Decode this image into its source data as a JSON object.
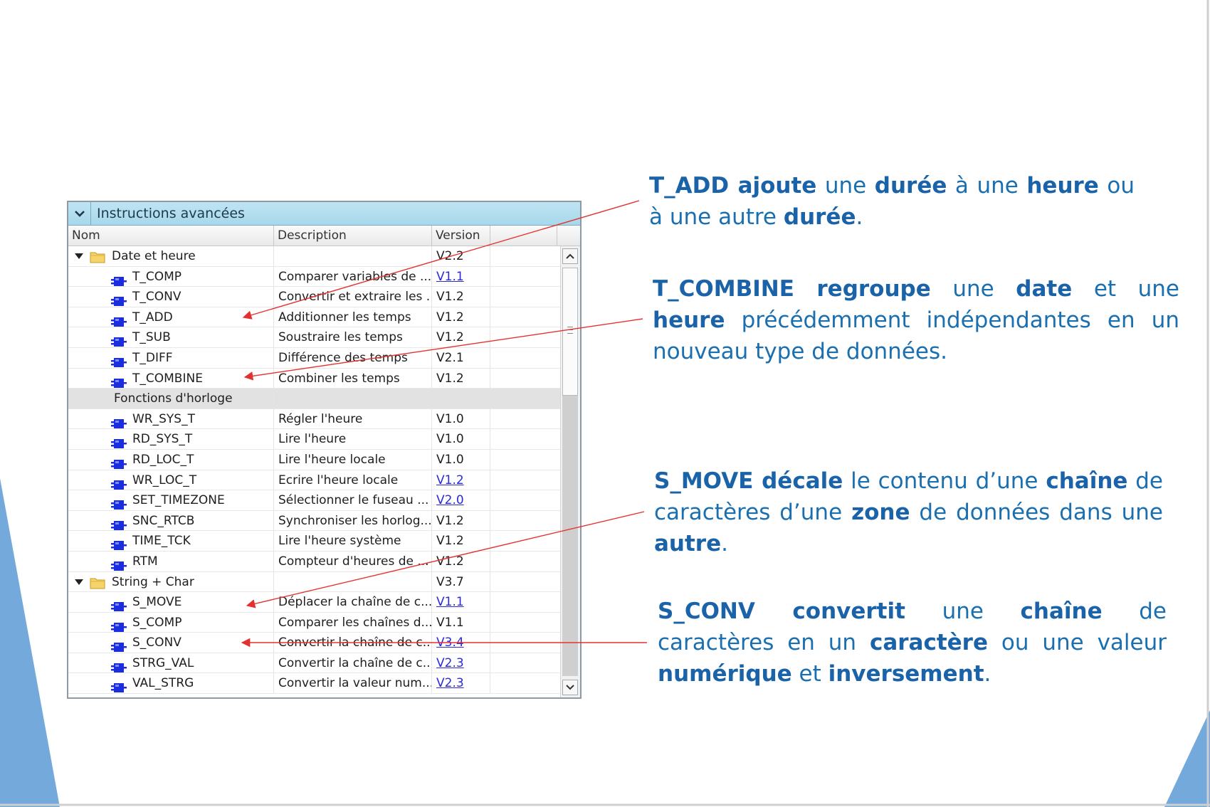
{
  "panel": {
    "title": "Instructions avancées",
    "columns": {
      "name": "Nom",
      "description": "Description",
      "version": "Version"
    }
  },
  "rows": [
    {
      "type": "folder",
      "name": "Date et heure",
      "desc": "",
      "version": "V2.2",
      "link": false
    },
    {
      "type": "item",
      "name": "T_COMP",
      "desc": "Comparer variables de ...",
      "version": "V1.1",
      "link": true
    },
    {
      "type": "item",
      "name": "T_CONV",
      "desc": "Convertir et extraire les ...",
      "version": "V1.2",
      "link": false
    },
    {
      "type": "item",
      "name": "T_ADD",
      "desc": "Additionner les temps",
      "version": "V1.2",
      "link": false
    },
    {
      "type": "item",
      "name": "T_SUB",
      "desc": "Soustraire les temps",
      "version": "V1.2",
      "link": false
    },
    {
      "type": "item",
      "name": "T_DIFF",
      "desc": "Différence des temps",
      "version": "V2.1",
      "link": false
    },
    {
      "type": "item",
      "name": "T_COMBINE",
      "desc": "Combiner les temps",
      "version": "V1.2",
      "link": false
    },
    {
      "type": "group",
      "name": "Fonctions d'horloge",
      "desc": "",
      "version": "",
      "link": false
    },
    {
      "type": "item",
      "name": "WR_SYS_T",
      "desc": "Régler l'heure",
      "version": "V1.0",
      "link": false
    },
    {
      "type": "item",
      "name": "RD_SYS_T",
      "desc": "Lire l'heure",
      "version": "V1.0",
      "link": false
    },
    {
      "type": "item",
      "name": "RD_LOC_T",
      "desc": "Lire l'heure locale",
      "version": "V1.0",
      "link": false
    },
    {
      "type": "item",
      "name": "WR_LOC_T",
      "desc": "Ecrire l'heure locale",
      "version": "V1.2",
      "link": true
    },
    {
      "type": "item",
      "name": "SET_TIMEZONE",
      "desc": "Sélectionner le fuseau ...",
      "version": "V2.0",
      "link": true
    },
    {
      "type": "item",
      "name": "SNC_RTCB",
      "desc": "Synchroniser les horlog...",
      "version": "V1.2",
      "link": false
    },
    {
      "type": "item",
      "name": "TIME_TCK",
      "desc": "Lire l'heure système",
      "version": "V1.2",
      "link": false
    },
    {
      "type": "item",
      "name": "RTM",
      "desc": "Compteur d'heures de ...",
      "version": "V1.2",
      "link": false
    },
    {
      "type": "folder",
      "name": "String + Char",
      "desc": "",
      "version": "V3.7",
      "link": false
    },
    {
      "type": "item",
      "name": "S_MOVE",
      "desc": "Déplacer la chaîne de c...",
      "version": "V1.1",
      "link": true
    },
    {
      "type": "item",
      "name": "S_COMP",
      "desc": "Comparer les chaînes d...",
      "version": "V1.1",
      "link": false
    },
    {
      "type": "item",
      "name": "S_CONV",
      "desc": "Convertir la chaîne de c...",
      "version": "V3.4",
      "link": true
    },
    {
      "type": "item",
      "name": "STRG_VAL",
      "desc": "Convertir la chaîne de c...",
      "version": "V2.3",
      "link": true
    },
    {
      "type": "item",
      "name": "VAL_STRG",
      "desc": "Convertir la valeur num...",
      "version": "V2.3",
      "link": true
    }
  ],
  "notes": {
    "t_add": [
      {
        "t": "T_ADD ajoute",
        "b": true
      },
      {
        "t": " une ",
        "b": false
      },
      {
        "t": "durée",
        "b": true
      },
      {
        "t": " à une ",
        "b": false
      },
      {
        "t": "heure",
        "b": true
      },
      {
        "t": " ou à une autre ",
        "b": false
      },
      {
        "t": "durée",
        "b": true
      },
      {
        "t": ".",
        "b": false
      }
    ],
    "t_combine": [
      {
        "t": "T_COMBINE regroupe",
        "b": true
      },
      {
        "t": " une ",
        "b": false
      },
      {
        "t": "date",
        "b": true
      },
      {
        "t": " et une ",
        "b": false
      },
      {
        "t": "heure",
        "b": true
      },
      {
        "t": " précédemment indépendantes en un nouveau type de données.",
        "b": false
      }
    ],
    "s_move": [
      {
        "t": "S_MOVE décale",
        "b": true
      },
      {
        "t": " le contenu d’une ",
        "b": false
      },
      {
        "t": "chaîne",
        "b": true
      },
      {
        "t": " de caractères d’une ",
        "b": false
      },
      {
        "t": "zone",
        "b": true
      },
      {
        "t": " de données dans une ",
        "b": false
      },
      {
        "t": "autre",
        "b": true
      },
      {
        "t": ".",
        "b": false
      }
    ],
    "s_conv": [
      {
        "t": "S_CONV convertit",
        "b": true
      },
      {
        "t": " une ",
        "b": false
      },
      {
        "t": "chaîne",
        "b": true
      },
      {
        "t": " de caractères en un ",
        "b": false
      },
      {
        "t": "caractère",
        "b": true
      },
      {
        "t": " ou une valeur ",
        "b": false
      },
      {
        "t": "numérique",
        "b": true
      },
      {
        "t": " et ",
        "b": false
      },
      {
        "t": "inversement",
        "b": true
      },
      {
        "t": ".",
        "b": false
      }
    ]
  },
  "colors": {
    "note_text": "#1a6fb0",
    "arrow": "#e53030",
    "slide_accent": "#5b9bd5",
    "header_bg": "#aedaec",
    "link": "#2a2ad8",
    "block_icon": "#1a2ee0"
  },
  "icons": {
    "collapse": "chevron-down-icon",
    "folder": "folder-icon",
    "block": "function-block-icon"
  }
}
